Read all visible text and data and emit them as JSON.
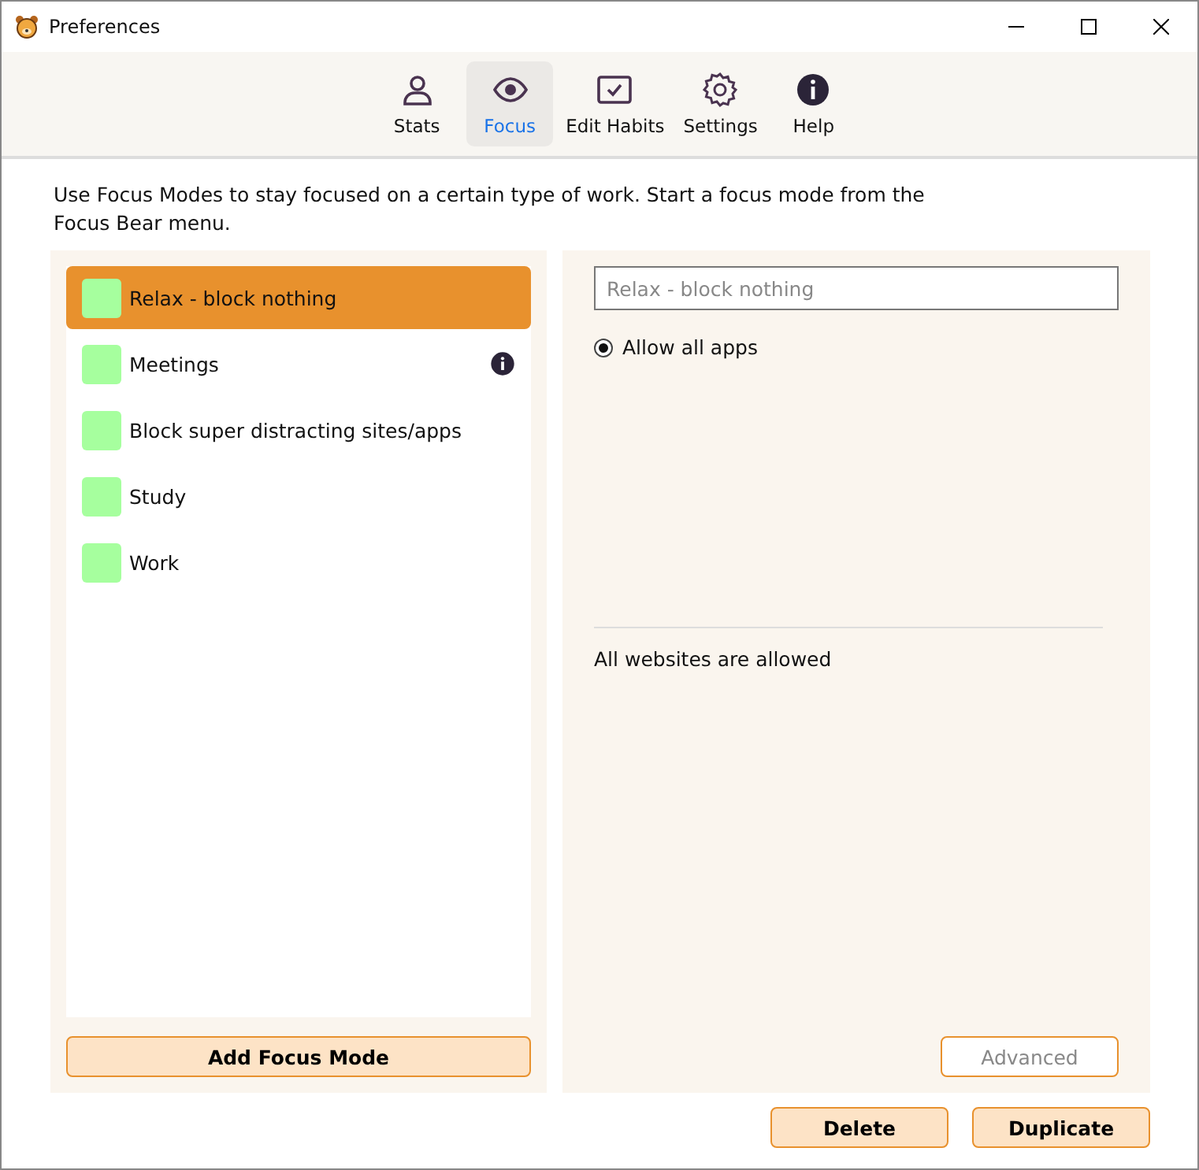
{
  "window": {
    "title": "Preferences"
  },
  "tabs": [
    {
      "label": "Stats",
      "kind": "person",
      "selected": false
    },
    {
      "label": "Focus",
      "kind": "eye",
      "selected": true
    },
    {
      "label": "Edit Habits",
      "kind": "check",
      "selected": false
    },
    {
      "label": "Settings",
      "kind": "gear",
      "selected": false
    },
    {
      "label": "Help",
      "kind": "info",
      "selected": false
    }
  ],
  "description": "Use Focus Modes to stay focused on a certain type of work. Start a focus mode from the Focus Bear menu.",
  "modes": [
    {
      "name": "Relax - block nothing",
      "color": "#a6ff9e",
      "selected": true,
      "info": false
    },
    {
      "name": "Meetings",
      "color": "#a6ff9e",
      "selected": false,
      "info": true
    },
    {
      "name": "Block super distracting sites/apps",
      "color": "#a6ff9e",
      "selected": false,
      "info": false
    },
    {
      "name": "Study",
      "color": "#a6ff9e",
      "selected": false,
      "info": false
    },
    {
      "name": "Work",
      "color": "#a6ff9e",
      "selected": false,
      "info": false
    }
  ],
  "add_button": "Add Focus Mode",
  "detail": {
    "name_field": {
      "placeholder": "Relax - block nothing"
    },
    "app_option": {
      "label": "Allow all apps",
      "checked": true
    },
    "websites_text": "All websites are allowed",
    "advanced_button": {
      "label": "Advanced",
      "disabled": true
    }
  },
  "buttons": [
    "Delete",
    "Duplicate"
  ]
}
